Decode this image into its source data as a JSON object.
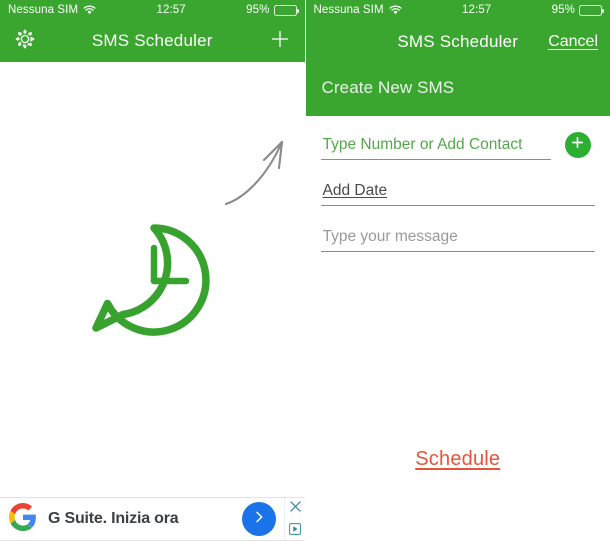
{
  "theme": {
    "green": "#3aa52f",
    "green_button": "#2cae32",
    "accent_orange": "#e2553a",
    "ad_blue": "#1a73e8",
    "white": "#ffffff"
  },
  "status_bar": {
    "carrier": "Nessuna SIM",
    "wifi_icon": "wifi-icon",
    "time": "12:57",
    "battery_percent": "95%",
    "battery_level": 95,
    "battery_icon": "battery-icon"
  },
  "left_screen": {
    "navbar": {
      "settings_icon": "gear-icon",
      "title": "SMS Scheduler",
      "add_icon": "plus-icon"
    },
    "empty_state": {
      "illustration": "clock-speech-bubble-icon"
    },
    "annotation": {
      "arrow_icon": "hand-drawn-curved-arrow-icon"
    },
    "ad": {
      "advertiser_icon": "google-logo-icon",
      "text": "G Suite. Inizia ora",
      "cta_icon": "chevron-right-icon",
      "close_icon": "close-icon",
      "adchoices_icon": "adchoices-icon"
    }
  },
  "right_screen": {
    "navbar": {
      "title": "SMS Scheduler",
      "cancel_label": "Cancel"
    },
    "subtitle": "Create New SMS",
    "form": {
      "number_field": {
        "value": "",
        "placeholder": "Type Number or Add Contact",
        "add_icon": "plus-circle-icon"
      },
      "date_field": {
        "label": "Add Date"
      },
      "message_field": {
        "value": "",
        "placeholder": "Type your message"
      }
    },
    "submit_label": "Schedule"
  }
}
